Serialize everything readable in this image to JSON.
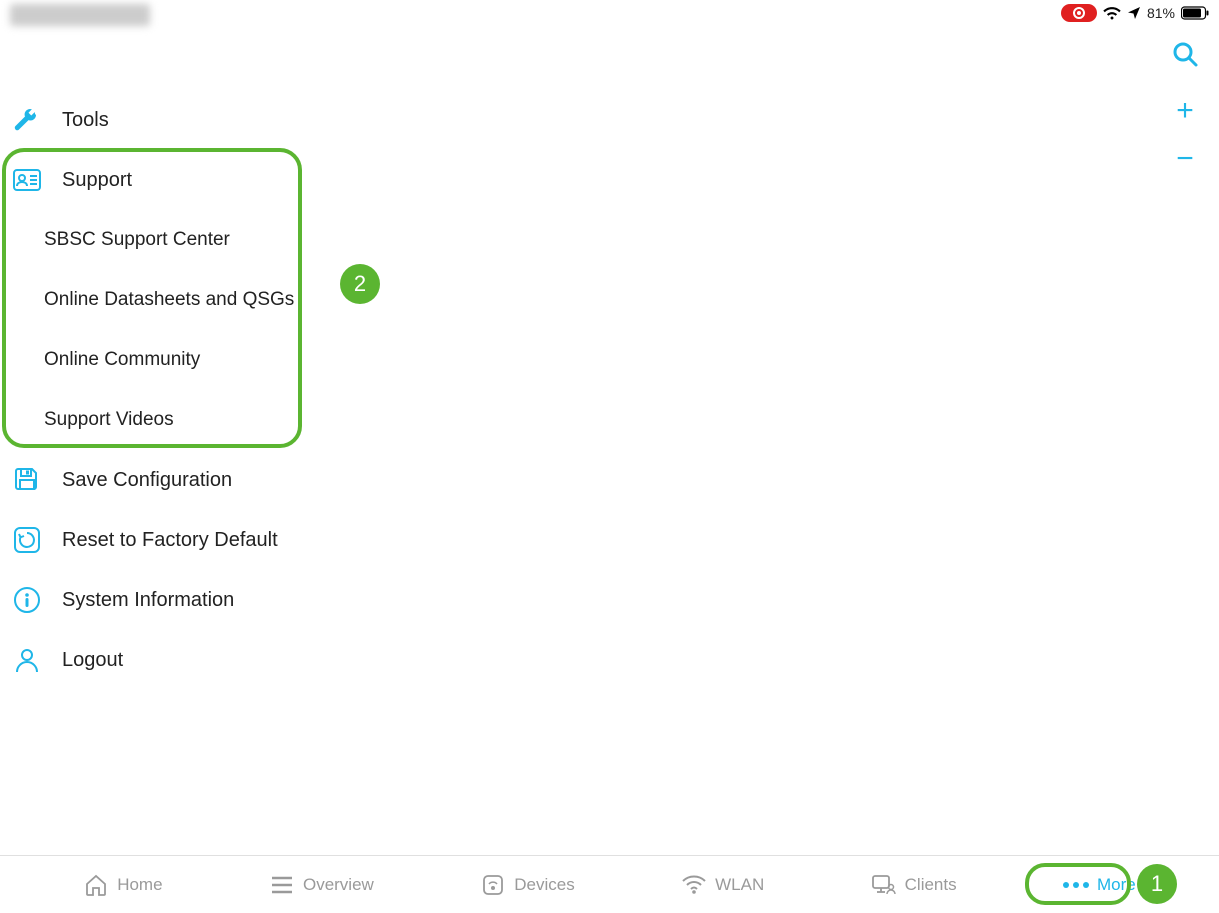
{
  "status": {
    "battery_pct": "81%"
  },
  "menu": {
    "tools": "Tools",
    "support": "Support",
    "support_items": [
      "SBSC Support Center",
      "Online Datasheets and QSGs",
      "Online Community",
      "Support Videos"
    ],
    "save_config": "Save Configuration",
    "factory_reset": "Reset to Factory Default",
    "system_info": "System Information",
    "logout": "Logout"
  },
  "nav": {
    "home": "Home",
    "overview": "Overview",
    "devices": "Devices",
    "wlan": "WLAN",
    "clients": "Clients",
    "more": "More"
  },
  "callouts": {
    "one": "1",
    "two": "2"
  }
}
